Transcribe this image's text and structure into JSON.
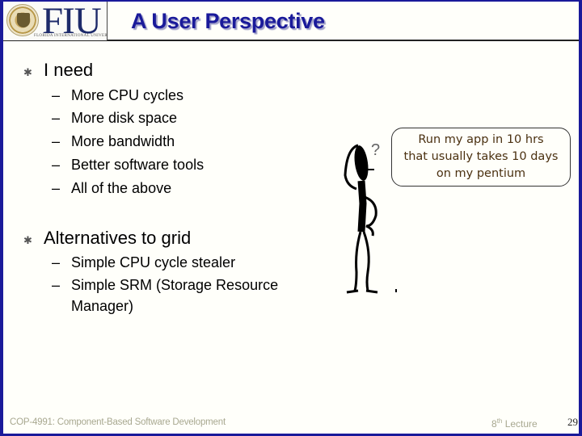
{
  "header": {
    "logo_text": "FIU",
    "logo_subtext": "FLORIDA INTERNATIONAL UNIVERSITY",
    "title": "A User Perspective"
  },
  "bullets": [
    {
      "text": "I need",
      "subitems": [
        "More CPU cycles",
        "More disk space",
        "More bandwidth",
        "Better software tools",
        "All of the above"
      ]
    },
    {
      "text": "Alternatives to grid",
      "subitems": [
        "Simple CPU cycle stealer",
        "Simple SRM (Storage Resource",
        "Manager)"
      ]
    }
  ],
  "speech_bubble": {
    "lines": [
      "Run my app in 10 hrs",
      "that usually takes 10 days",
      "on my pentium"
    ]
  },
  "figure": {
    "question_mark": "?"
  },
  "footer": {
    "course": "COP-4991: Component-Based Software Development",
    "lecture_number": "8",
    "lecture_suffix": "th",
    "lecture_label": " Lecture",
    "page_number": "29"
  },
  "symbols": {
    "bullet_icon": "✱",
    "dash": "–"
  },
  "colors": {
    "frame": "#1a1a9a",
    "title": "#1a1a9a",
    "background": "#fffffa",
    "footer_text": "#a8a890"
  }
}
